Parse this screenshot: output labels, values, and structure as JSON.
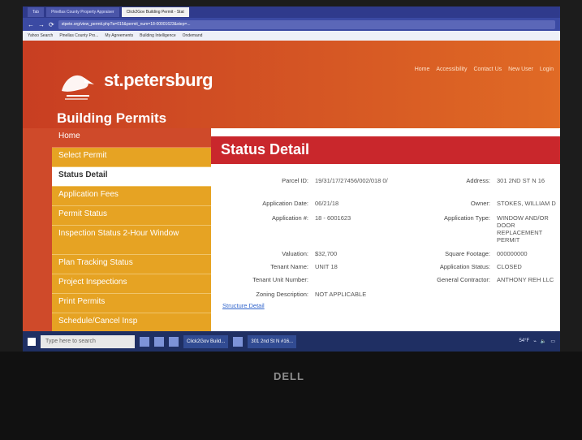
{
  "browser": {
    "tabs": [
      {
        "label": "Tab"
      },
      {
        "label": "Pinellas County Property Appraiser"
      },
      {
        "label": "Click2Gov Building Permit - Stat"
      }
    ],
    "url": "stpete.org/view_permit.php?a=015&permit_num=18-00001623&step=...",
    "bookmarks": [
      "Yahoo Search",
      "Pinellas County Pro...",
      "My Agreements",
      "Building Intelligence",
      "Ondemand"
    ]
  },
  "site": {
    "logo_text": "st.petersburg",
    "subtitle": "Building Permits",
    "top_nav": [
      "Home",
      "Accessibility",
      "Contact Us",
      "New User",
      "Login"
    ]
  },
  "sidebar": {
    "items": [
      {
        "label": "Home"
      },
      {
        "label": "Select Permit"
      },
      {
        "label": "Status Detail"
      },
      {
        "label": "Application Fees"
      },
      {
        "label": "Permit Status"
      },
      {
        "label": "Inspection Status 2-Hour Window"
      },
      {
        "label": "Plan Tracking Status"
      },
      {
        "label": "Project Inspections"
      },
      {
        "label": "Print Permits"
      },
      {
        "label": "Schedule/Cancel Insp"
      }
    ]
  },
  "main": {
    "title": "Status Detail",
    "fields": {
      "parcel_id_label": "Parcel ID:",
      "parcel_id_value": "19/31/17/27456/002/018 0/",
      "address_label": "Address:",
      "address_value": "301 2ND ST N 16",
      "application_date_label": "Application Date:",
      "application_date_value": "06/21/18",
      "owner_label": "Owner:",
      "owner_value": "STOKES, WILLIAM D",
      "application_num_label": "Application #:",
      "application_num_value": "18 - 6001623",
      "application_type_label": "Application Type:",
      "application_type_value": "WINDOW AND/OR DOOR REPLACEMENT PERMIT",
      "valuation_label": "Valuation:",
      "valuation_value": "$32,700",
      "square_footage_label": "Square Footage:",
      "square_footage_value": "000000000",
      "tenant_name_label": "Tenant Name:",
      "tenant_name_value": "UNIT 18",
      "application_status_label": "Application Status:",
      "application_status_value": "CLOSED",
      "tenant_unit_label": "Tenant Unit Number:",
      "tenant_unit_value": "",
      "general_contractor_label": "General Contractor:",
      "general_contractor_value": "ANTHONY REH LLC",
      "zoning_label": "Zoning Description:",
      "zoning_value": "NOT APPLICABLE"
    },
    "structure_link": "Structure Detail"
  },
  "taskbar": {
    "search_placeholder": "Type here to search",
    "open_items": [
      "Click2Gov Build...",
      "301 2nd St N #16..."
    ],
    "temperature": "54°F"
  },
  "device": {
    "brand": "DELL"
  }
}
